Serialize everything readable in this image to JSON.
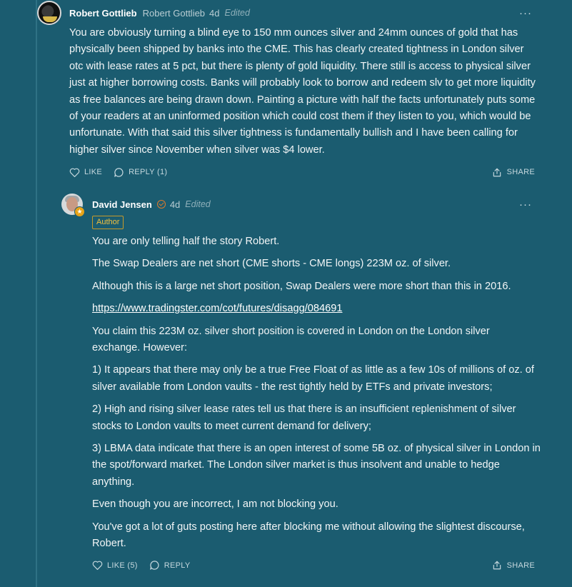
{
  "comment1": {
    "author": "Robert Gottlieb",
    "handle": "Robert Gottlieb",
    "time": "4d",
    "edited": "Edited",
    "more": "···",
    "body": "You are obviously turning a blind eye to 150 mm ounces silver and 24mm ounces of gold that has physically been shipped by banks into the CME. This has clearly created tightness in London silver otc with lease rates at 5 pct, but there is plenty of gold liquidity. There still is access to physical silver just at higher borrowing costs. Banks will probably look to borrow and redeem slv to get more liquidity as free balances are being drawn down. Painting a picture with half the facts unfortunately puts some of your readers at an uninformed position which could cost them if they listen to you, which would be unfortunate. With that said this silver tightness is fundamentally bullish and I have been calling for higher silver since November when silver was $4 lower.",
    "like_label": "LIKE",
    "reply_label": "REPLY (1)",
    "share_label": "SHARE"
  },
  "comment2": {
    "author": "David Jensen",
    "time": "4d",
    "edited": "Edited",
    "more": "···",
    "author_badge": "Author",
    "paragraphs": [
      "You are only telling half the story Robert.",
      "The Swap Dealers are net short (CME shorts - CME longs) 223M oz. of silver.",
      "Although this is a large net short position, Swap Dealers were more short than this in 2016."
    ],
    "link": "https://www.tradingster.com/cot/futures/disagg/084691",
    "paragraphs_after": [
      "You claim this 223M oz. silver short position is covered in London on the London silver exchange. However:",
      "1) It appears that there may only be a true Free Float of as little as a few 10s of millions of oz. of silver available from London vaults - the rest tightly held by ETFs and private investors;",
      "2) High and rising silver lease rates tell us that there is an insufficient replenishment of silver stocks to London vaults to meet current demand for delivery;",
      "3) LBMA data indicate that there is an open interest of some 5B oz. of physical silver in London in the spot/forward market. The London silver market is thus insolvent and unable to hedge anything.",
      "Even though you are incorrect, I am not blocking you.",
      "You've got a lot of guts posting here after blocking me without allowing the slightest discourse, Robert."
    ],
    "like_label": "LIKE (5)",
    "reply_label": "REPLY",
    "share_label": "SHARE"
  },
  "colors": {
    "background": "#1b5c70",
    "author_badge": "#f0c040",
    "verified": "#e07a2a"
  }
}
